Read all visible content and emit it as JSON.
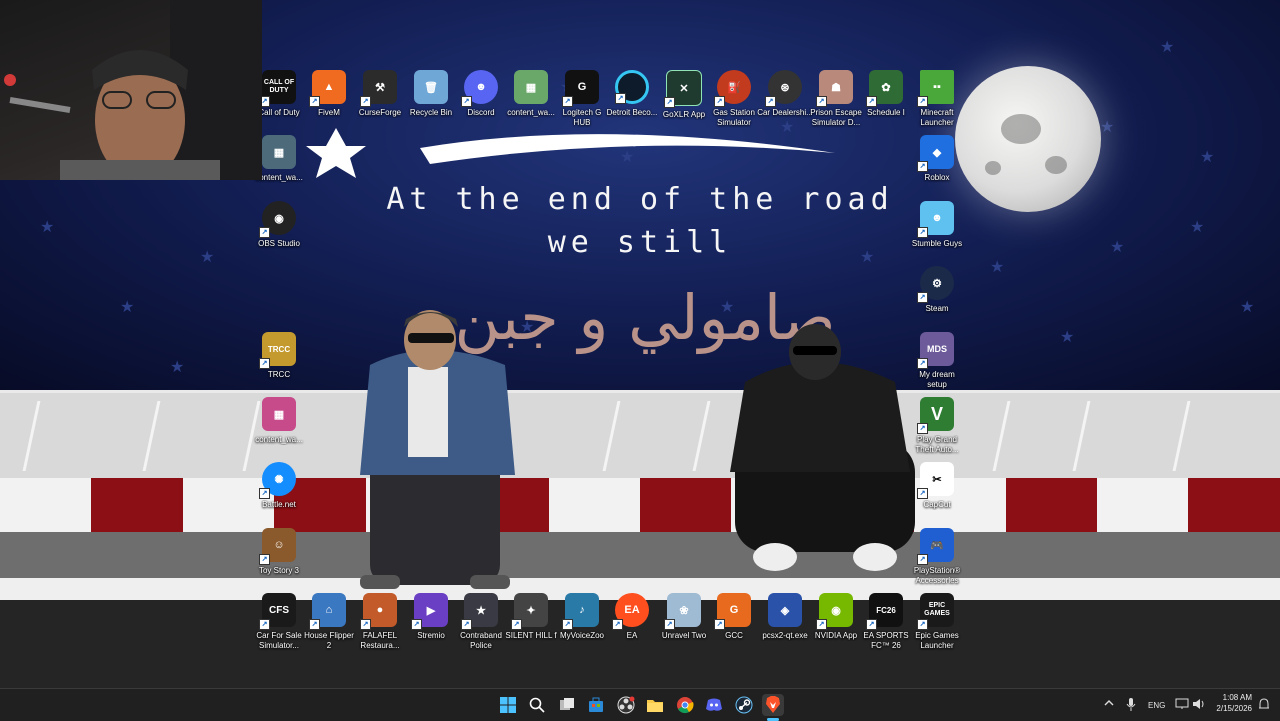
{
  "wallpaper": {
    "slogan_line1": "At the end of the road",
    "slogan_line2": "we still",
    "arabic_text": "صامولي و جبن"
  },
  "desktop_icons": {
    "call_of_duty": "Call of Duty",
    "fivem": "FiveM",
    "curseforge": "CurseForge",
    "recycle_bin": "Recycle Bin",
    "discord": "Discord",
    "content_wa_1": "content_wa...",
    "logitech": "Logitech G HUB",
    "detroit": "Detroit Beco...",
    "goxlr": "GoXLR App",
    "gas_station": "Gas Station Simulator",
    "car_dealership": "Car Dealershi...",
    "prison_escape": "Prison Escape Simulator D...",
    "schedule": "Schedule I",
    "minecraft": "Minecraft Launcher",
    "content_wa_2": "content_wa...",
    "roblox": "Roblox",
    "obs": "OBS Studio",
    "stumble": "Stumble Guys",
    "steam": "Steam",
    "trcc": "TRCC",
    "dream_setup": "My dream setup",
    "content_wa_3": "content_wa...",
    "gta": "Play Grand Theft Auto...",
    "battlenet": "Battle.net",
    "capcut": "CapCut",
    "toy_story": "Toy Story 3",
    "ps_accessories": "PlayStation® Accessories",
    "car_for_sale": "Car For Sale Simulator...",
    "house_flipper": "House Flipper 2",
    "falafel": "FALAFEL Restaura...",
    "stremio": "Stremio",
    "contraband": "Contraband Police",
    "silent_hill": "SILENT HILL f",
    "myvoicezoo": "MyVoiceZoo",
    "ea": "EA",
    "unravel": "Unravel Two",
    "gcc": "GCC",
    "pcsx2": "pcsx2-qt.exe",
    "nvidia": "NVIDIA App",
    "ea_fc": "EA SPORTS FC™ 26",
    "epic": "Epic Games Launcher",
    "icon_text": {
      "call_of_duty": "CALL OF DUTY",
      "epic": "EPIC GAMES",
      "trcc": "TRCC",
      "cfs": "CFS",
      "mds": "MDS",
      "easports": "FC26"
    }
  },
  "taskbar": {
    "language": "ENG",
    "time": "1:08 AM",
    "date": "2/15/2026"
  },
  "colors": {
    "accent": "#0078d4",
    "curb_red": "#8b0f14",
    "curb_white": "#f2f2f2",
    "arabic_text": "#b99389"
  }
}
